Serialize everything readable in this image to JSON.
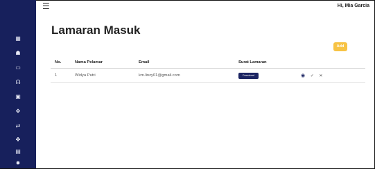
{
  "colors": {
    "sidebar": "#17205c",
    "accent_add": "#f7c344",
    "download_button": "#1c2563"
  },
  "header": {
    "menu_icon": "hamburger-icon",
    "greeting": "Hi, Mia Garcia"
  },
  "sidebar": {
    "items": [
      {
        "icon": "grid-icon",
        "glyph": "▦"
      },
      {
        "icon": "users-icon",
        "glyph": "☗"
      },
      {
        "icon": "inbox-icon",
        "glyph": "▭"
      },
      {
        "icon": "user-plus-icon",
        "glyph": "☊"
      },
      {
        "icon": "clipboard-icon",
        "glyph": "▣"
      },
      {
        "icon": "move-icon",
        "glyph": "✥"
      },
      {
        "icon": "swap-icon",
        "glyph": "⇄"
      },
      {
        "icon": "tree-icon",
        "glyph": "✤"
      },
      {
        "icon": "calendar-icon",
        "glyph": "▤"
      },
      {
        "icon": "lightbulb-icon",
        "glyph": "✸"
      }
    ]
  },
  "main": {
    "title": "Lamaran Masuk",
    "add_label": "Add",
    "table": {
      "headers": [
        "No.",
        "Nama Pelamar",
        "Email",
        "Surat Lamaran",
        ""
      ],
      "rows": [
        {
          "no": "1",
          "name": "Widya Putri",
          "email": "km.linzy01@gmail.com",
          "download_label": "Download"
        }
      ]
    }
  }
}
